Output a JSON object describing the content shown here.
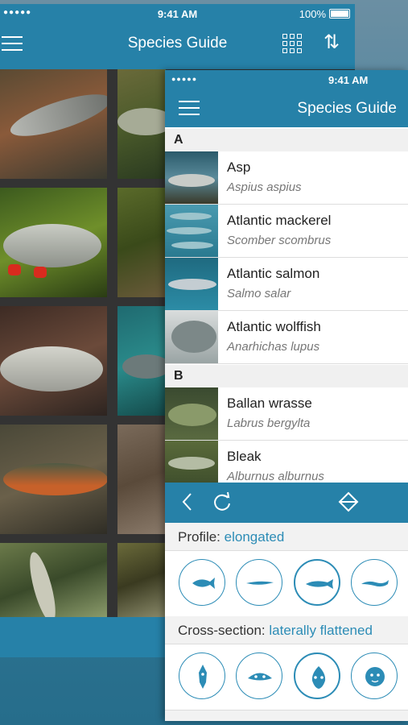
{
  "back": {
    "status": {
      "signal": "●●●●● ",
      "time": "9:41 AM",
      "battery": "100%"
    },
    "title": "Species Guide",
    "icons": {
      "menu": "hamburger-icon",
      "grid": "grid-icon",
      "sort": "sort-icon"
    }
  },
  "front": {
    "status": {
      "signal": "●●●●● ",
      "time": "9:41 AM"
    },
    "title": "Species Guide",
    "sections": [
      {
        "letter": "A"
      },
      {
        "letter": "B"
      }
    ],
    "species": [
      {
        "name": "Asp",
        "latin": "Aspius aspius"
      },
      {
        "name": "Atlantic mackerel",
        "latin": "Scomber scombrus"
      },
      {
        "name": "Atlantic salmon",
        "latin": "Salmo salar"
      },
      {
        "name": "Atlantic wolffish",
        "latin": "Anarhichas lupus"
      },
      {
        "name": "Ballan wrasse",
        "latin": "Labrus bergylta"
      },
      {
        "name": "Bleak",
        "latin": "Alburnus alburnus"
      }
    ],
    "filter": {
      "toolbar": {
        "back": "back-chevron-icon",
        "reset": "refresh-icon",
        "collapse": "diamond-toggle-icon"
      },
      "profile": {
        "label": "Profile:",
        "value": "elongated",
        "options": [
          "fusiform",
          "eel-like",
          "elongated",
          "ribbon"
        ],
        "selected": 2
      },
      "cross_section": {
        "label": "Cross-section:",
        "value": "laterally flattened",
        "options": [
          "compressed-tall",
          "depressed",
          "laterally flattened",
          "round"
        ],
        "selected": 2
      }
    },
    "accent": "#2c8cb6",
    "bar_color": "#2681a8"
  }
}
